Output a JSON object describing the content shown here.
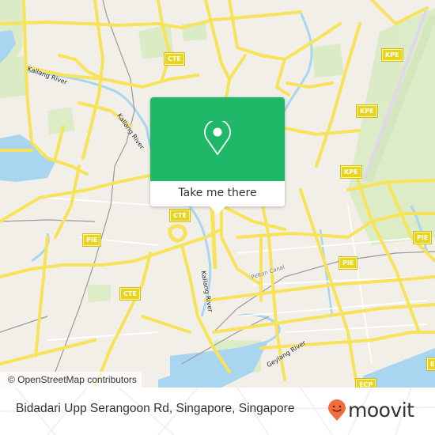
{
  "map": {
    "attribution": "© OpenStreetMap contributors",
    "road_labels": {
      "cte_1": "CTE",
      "cte_2": "CTE",
      "cte_3": "CTE",
      "kpe_1": "KPE",
      "kpe_2": "KPE",
      "kpe_3": "KPE",
      "pie_1": "PIE",
      "pie_2": "PIE",
      "pie_3": "PIE",
      "ecp_1": "ECP",
      "ecp_2": "E"
    },
    "water_labels": {
      "kallang_river_1": "Kallang River",
      "kallang_river_2": "Kallang River",
      "kallang_river_3": "Kallang River",
      "geylang_river": "Geylang River",
      "rochor_canal": "Pelton Canal"
    },
    "colors": {
      "land": "#f2efe9",
      "road": "#f7e35a",
      "water": "#a8d5ef",
      "park": "#d9ebc3",
      "popup_green": "#1fb869"
    }
  },
  "popup": {
    "icon": "location-pin-icon",
    "button_label": "Take me there"
  },
  "footer": {
    "address": "Bidadari Upp Serangoon Rd, Singapore, Singapore",
    "brand": "moovit",
    "brand_icon": "moovit-smile-pin-icon",
    "brand_color": "#f26b3a"
  }
}
